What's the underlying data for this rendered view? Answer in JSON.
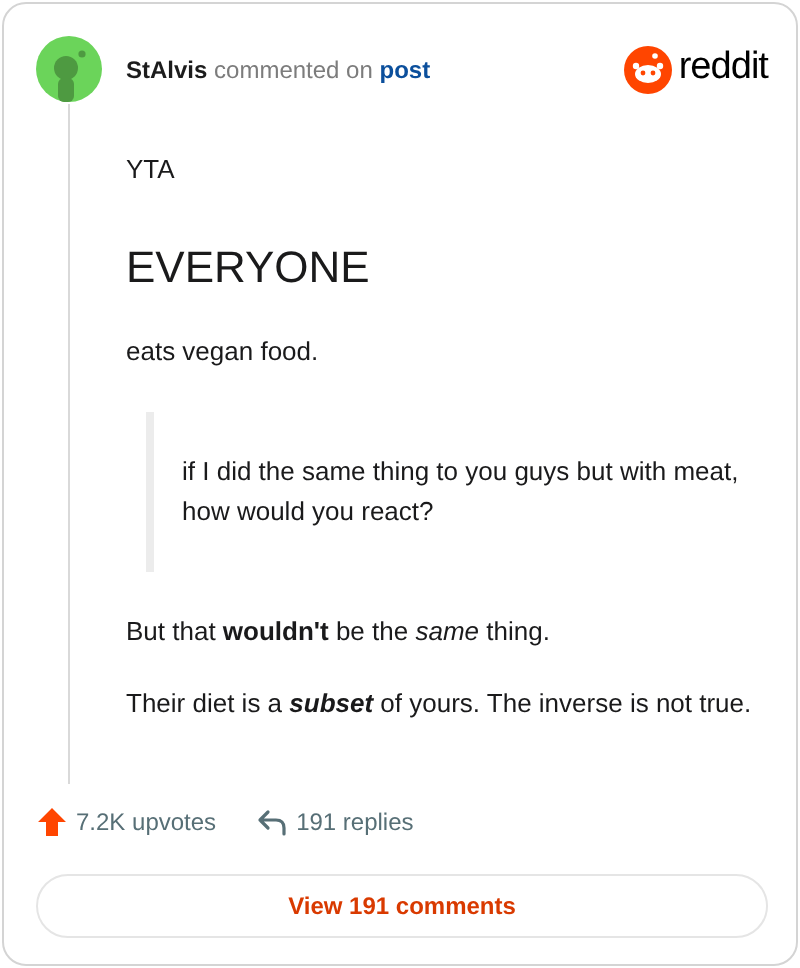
{
  "comment": {
    "author": "StAlvis",
    "action": "commented on",
    "link": "post"
  },
  "brand": {
    "name": "reddit"
  },
  "body": [
    {
      "kind": "paragraph",
      "text": "YTA"
    },
    {
      "kind": "heading",
      "text": "EVERYONE"
    },
    {
      "kind": "paragraph",
      "text": "eats vegan food."
    },
    {
      "kind": "quote",
      "text": "if I did the same thing to you guys but with meat, how would you react?"
    },
    {
      "kind": "paragraph",
      "text": "But that **wouldn't** be the *same* thing."
    },
    {
      "kind": "segments",
      "parts": [
        {
          "text": "Their diet is a ",
          "bold": false,
          "italic": false
        },
        {
          "text": "subset",
          "bold": true,
          "italic": true
        },
        {
          "text": " of yours. The inverse is not true.",
          "bold": false,
          "italic": false
        }
      ]
    }
  ],
  "stats": {
    "upvotes": "7.2K upvotes",
    "replies": "191 replies"
  },
  "view_button": "View 191 comments"
}
